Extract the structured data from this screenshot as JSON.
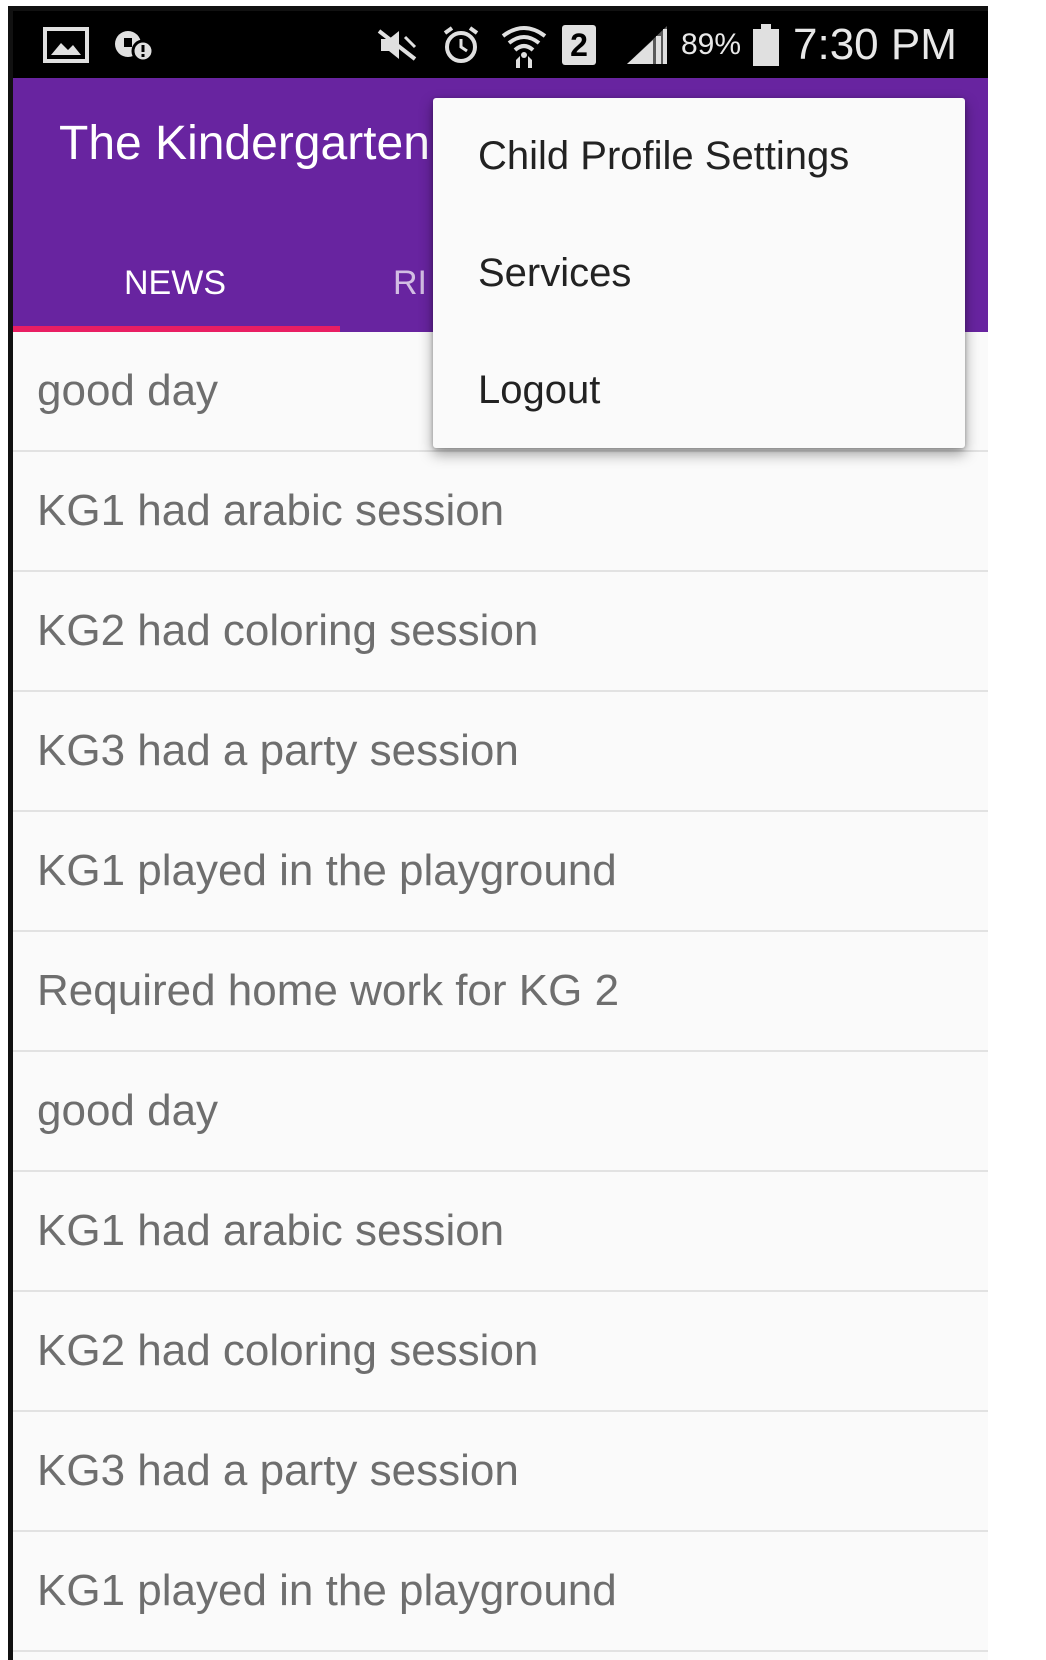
{
  "status_bar": {
    "icons_left": [
      "gallery-icon",
      "notification-alert-icon"
    ],
    "icons_right": [
      "mute-icon",
      "alarm-icon",
      "wifi-icon",
      "sim-icon",
      "signal-icon",
      "battery-icon"
    ],
    "sim_number": "2",
    "battery_percent": "89%",
    "time": "7:30 PM"
  },
  "app_bar": {
    "title": "The Kindergarten",
    "tabs": [
      {
        "label": "NEWS",
        "selected": true
      },
      {
        "label": "RI",
        "selected": false
      }
    ]
  },
  "news": {
    "items": [
      {
        "text": "good day"
      },
      {
        "text": "KG1 had arabic session"
      },
      {
        "text": "KG2 had coloring session"
      },
      {
        "text": "KG3 had a party session"
      },
      {
        "text": "KG1 played in the playground"
      },
      {
        "text": "Required home work for KG 2"
      },
      {
        "text": "good day"
      },
      {
        "text": "KG1 had arabic session"
      },
      {
        "text": "KG2 had coloring session"
      },
      {
        "text": "KG3 had a party session"
      },
      {
        "text": "KG1 played in the playground"
      }
    ]
  },
  "overflow_menu": {
    "items": [
      {
        "label": "Child Profile Settings"
      },
      {
        "label": "Services"
      },
      {
        "label": "Logout"
      }
    ]
  },
  "colors": {
    "app_bar": "#6824a0",
    "tab_indicator": "#e91e63",
    "list_text": "#6e6e6e",
    "menu_text": "#222222",
    "background": "#fafafa"
  }
}
